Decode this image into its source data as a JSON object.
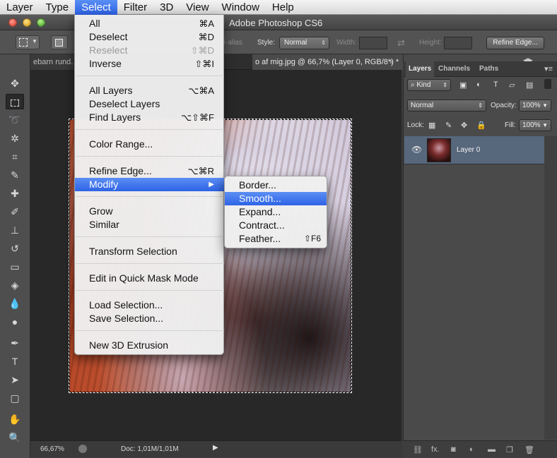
{
  "menubar": {
    "items": [
      "Layer",
      "Type",
      "Select",
      "Filter",
      "3D",
      "View",
      "Window",
      "Help"
    ],
    "active": "Select"
  },
  "app": {
    "title": "Adobe Photoshop CS6"
  },
  "options_bar": {
    "anti_alias_label": "ti-alias",
    "style_label": "Style:",
    "style_value": "Normal",
    "width_label": "Width:",
    "height_label": "Height:",
    "refine_edge_label": "Refine Edge..."
  },
  "document_tabs": {
    "tab1": "ebarn rund.",
    "tab2": "o af mig.jpg @ 66,7% (Layer 0, RGB/8*) *",
    "overflow": "»"
  },
  "status_bar": {
    "zoom": "66,67%",
    "doc_size": "Doc: 1,01M/1,01M"
  },
  "layers_panel": {
    "tabs": [
      "Layers",
      "Channels",
      "Paths"
    ],
    "kind_label": "Kind",
    "blend_mode": "Normal",
    "opacity_label": "Opacity:",
    "opacity_value": "100%",
    "lock_label": "Lock:",
    "fill_label": "Fill:",
    "fill_value": "100%",
    "layer_name": "Layer 0"
  },
  "select_menu": {
    "all": {
      "label": "All",
      "shortcut": "⌘A"
    },
    "deselect": {
      "label": "Deselect",
      "shortcut": "⌘D"
    },
    "reselect": {
      "label": "Reselect",
      "shortcut": "⇧⌘D"
    },
    "inverse": {
      "label": "Inverse",
      "shortcut": "⇧⌘I"
    },
    "all_layers": {
      "label": "All Layers",
      "shortcut": "⌥⌘A"
    },
    "deselect_layers": {
      "label": "Deselect Layers"
    },
    "find_layers": {
      "label": "Find Layers",
      "shortcut": "⌥⇧⌘F"
    },
    "color_range": {
      "label": "Color Range..."
    },
    "refine_edge": {
      "label": "Refine Edge...",
      "shortcut": "⌥⌘R"
    },
    "modify": {
      "label": "Modify",
      "arrow": "▶"
    },
    "grow": {
      "label": "Grow"
    },
    "similar": {
      "label": "Similar"
    },
    "transform_selection": {
      "label": "Transform Selection"
    },
    "quick_mask": {
      "label": "Edit in Quick Mask Mode"
    },
    "load_selection": {
      "label": "Load Selection..."
    },
    "save_selection": {
      "label": "Save Selection..."
    },
    "new_3d_extrusion": {
      "label": "New 3D Extrusion"
    }
  },
  "modify_menu": {
    "border": {
      "label": "Border..."
    },
    "smooth": {
      "label": "Smooth..."
    },
    "expand": {
      "label": "Expand..."
    },
    "contract": {
      "label": "Contract..."
    },
    "feather": {
      "label": "Feather...",
      "shortcut": "⇧F6"
    }
  }
}
